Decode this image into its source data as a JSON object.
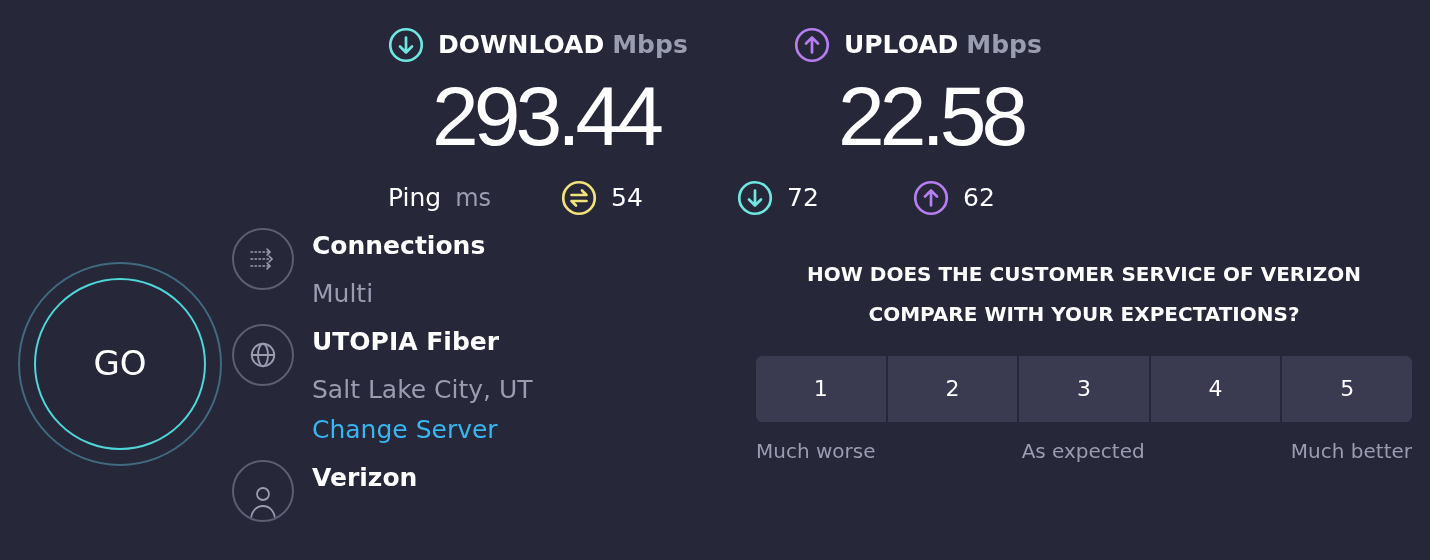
{
  "speeds": [
    {
      "kind": "download",
      "label": "DOWNLOAD",
      "unit": "Mbps",
      "value": "293.44",
      "color": "#6ee7e0"
    },
    {
      "kind": "upload",
      "label": "UPLOAD",
      "unit": "Mbps",
      "value": "22.58",
      "color": "#b67ef0"
    }
  ],
  "ping": {
    "label": "Ping",
    "unit": "ms",
    "readings": [
      {
        "kind": "ping",
        "value": "54",
        "color": "#f2e27a"
      },
      {
        "kind": "download",
        "value": "72",
        "color": "#6ee7e0"
      },
      {
        "kind": "upload",
        "value": "62",
        "color": "#b67ef0"
      }
    ]
  },
  "go_button": "GO",
  "info": [
    {
      "kind": "connections",
      "title": "Connections",
      "lines": [
        "Multi"
      ]
    },
    {
      "kind": "server",
      "title": "UTOPIA Fiber",
      "lines": [
        "Salt Lake City, UT"
      ],
      "link": "Change Server"
    },
    {
      "kind": "provider",
      "title": "Verizon"
    }
  ],
  "survey": {
    "question": "HOW DOES THE CUSTOMER SERVICE OF VERIZON COMPARE WITH YOUR EXPECTATIONS?",
    "options": [
      {
        "label": "1",
        "selected": false
      },
      {
        "label": "2",
        "selected": false
      },
      {
        "label": "3",
        "selected": false
      },
      {
        "label": "4",
        "selected": false
      },
      {
        "label": "5",
        "selected": false
      }
    ],
    "scale_labels": [
      "Much worse",
      "As expected",
      "Much better"
    ]
  }
}
